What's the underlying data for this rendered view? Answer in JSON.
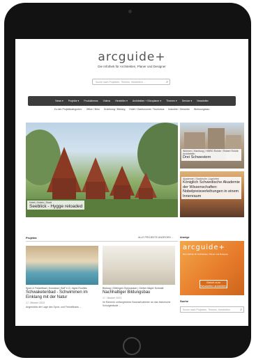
{
  "site": {
    "logo": "arcguide",
    "logo_plus": "+",
    "tagline": "Die Infothek für Architekten, Planer und Designer",
    "search_placeholder": "Suche nach Projekten, Themen, Herstellern ..."
  },
  "nav": {
    "items": [
      "News ▾",
      "Projekte ▾",
      "Produktnews",
      "Videos",
      "Hersteller ▾",
      "Architekten + Büroplaner ▾",
      "Themen ▾",
      "Service ▾",
      "Newsletter"
    ]
  },
  "subnav": {
    "items": [
      "Zu den Projektkategorien:",
      "Office / Büro",
      "Erziehung / Bildung",
      "Hotel / Gastronomie / Tourismus",
      "Industrie / Gewerbe",
      "Wohnungsbau"
    ]
  },
  "feature": {
    "tags": "Hotel | Hotels | Stadt",
    "title": "Seeblick - Hygge reloaded"
  },
  "side_stories": [
    {
      "tags": "Wohnen | Hamburg | HMRO Rohde / Robert Rohde Architekten",
      "title": "Drei Schwestern"
    },
    {
      "tags": "Akademie | Stockholm | Ligninfrei",
      "title": "Königlich Schwedische Akademie der Wissenschaften: Nobelpreisverleihungen in einem Innenraum"
    }
  ],
  "projekte": {
    "heading": "Projekte",
    "all_link": "ALLE PROJEKTE ANZEIGEN →",
    "cards": [
      {
        "meta": "Sport & Freizeitbad | Konstanz | BAF e.G. Ingrid Rochlitz",
        "title": "Schwaketenbad - Schwimmen im Einklang mit der Natur",
        "date": "17. Oktober 2023",
        "body": "Angesichts der Lage des Sport- und Freizeitbads ..."
      },
      {
        "meta": "Bildung | Göttingen Gymnasium | Gerber Mayer Schmidt",
        "title": "Nachhaltiger Bildungsbau",
        "date": "17. Oktober 2023",
        "body": "Im Rahmen umfangreicher Baumaßnahmen an das historische Schulgebäude ..."
      }
    ]
  },
  "sidebar": {
    "anzeige": "Anzeige",
    "ad": {
      "logo": "arcguide+",
      "subtitle": "Die Infothek für Architekten, Planer und Designer",
      "btn_line1": "Gleich zum",
      "btn_line2": "Newsletter anmelden"
    },
    "suche_heading": "Suche",
    "suche_placeholder": "Suche nach Projekten, Themen, Herstellern"
  },
  "colors": {
    "nav_bg": "#3c3c3c",
    "ad_orange": "#e67a2a"
  }
}
